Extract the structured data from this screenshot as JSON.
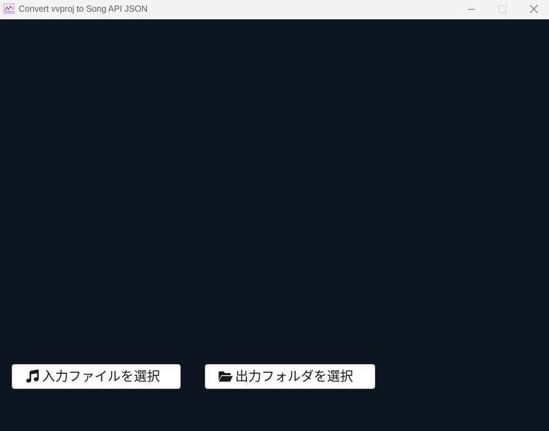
{
  "window": {
    "title": "Convert vvproj to Song API JSON"
  },
  "titlebar_buttons": {
    "minimize_icon": "minimize-icon",
    "maximize_icon": "maximize-icon",
    "close_icon": "close-icon"
  },
  "actions": {
    "input_button": {
      "label": "入力ファイルを選択",
      "icon": "music-note-icon"
    },
    "output_button": {
      "label": "出力フォルダを選択",
      "icon": "folder-open-icon"
    }
  },
  "colors": {
    "background": "#0d1520",
    "titlebar": "#f3f3f3",
    "button_background": "#ffffff",
    "button_text": "#1a1a1a"
  }
}
